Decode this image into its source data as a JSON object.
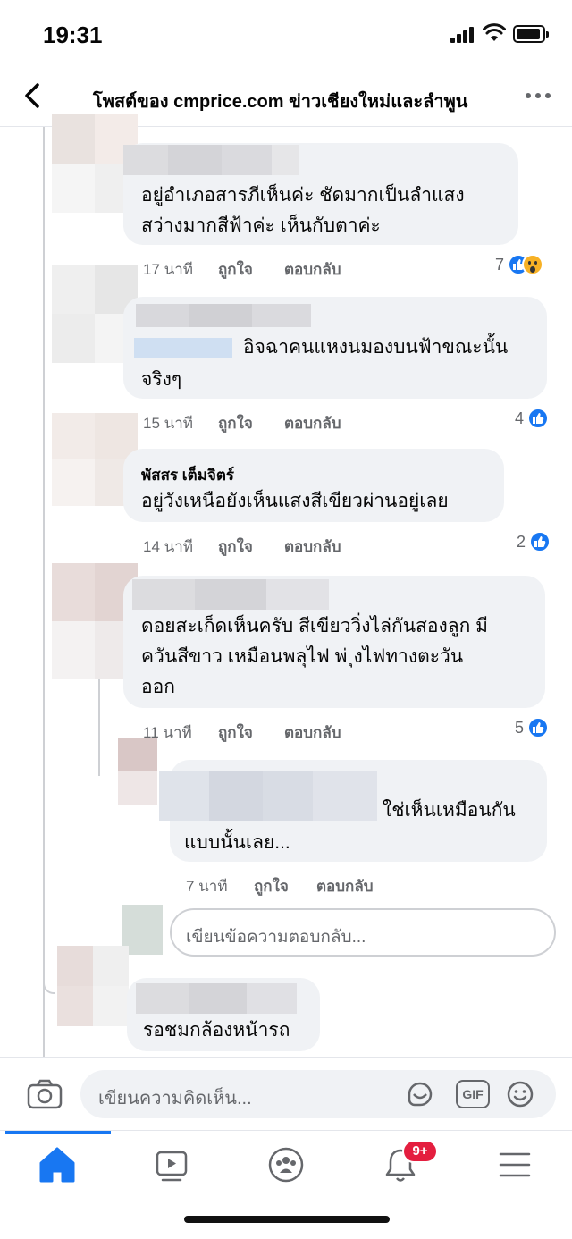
{
  "status_bar": {
    "time": "19:31"
  },
  "header": {
    "title": "โพสต์ของ cmprice.com ข่าวเชียงใหม่และลำพูน"
  },
  "comments": [
    {
      "name": "",
      "text_lines": [
        "อยู่อำเภอสารภีเห็นค่ะ ชัดมากเป็นลำแสง",
        "สว่างมากสีฟ้าค่ะ เห็นกับตาค่ะ"
      ],
      "time": "17 นาที",
      "like": "ถูกใจ",
      "reply": "ตอบกลับ",
      "reactions": "7",
      "reaction_icons": [
        "like-icon",
        "wow-icon"
      ]
    },
    {
      "name": "",
      "text_lines": [
        "อิจฉาคนแหงนมองบนฟ้าขณะนั้น",
        "จริงๆ"
      ],
      "time": "15 นาที",
      "like": "ถูกใจ",
      "reply": "ตอบกลับ",
      "reactions": "4",
      "reaction_icons": [
        "like-icon"
      ]
    },
    {
      "name": "พัสสร เต็มจิตร์",
      "text_lines": [
        "อยู่วังเหนือยังเห็นแสงสีเขียวผ่านอยู่เลย"
      ],
      "time": "14 นาที",
      "like": "ถูกใจ",
      "reply": "ตอบกลับ",
      "reactions": "2",
      "reaction_icons": [
        "like-icon"
      ]
    },
    {
      "name": "",
      "text_lines": [
        "ดอยสะเก็ดเห็นครับ สีเขียววิ่งไล่กันสองลูก มี",
        "ควันสีขาว เหมือนพลุไฟ   พ่ ุงไฟทางตะวัน",
        "ออก"
      ],
      "time": "11 นาที",
      "like": "ถูกใจ",
      "reply": "ตอบกลับ",
      "reactions": "5",
      "reaction_icons": [
        "like-icon"
      ]
    }
  ],
  "reply": {
    "text_lines": [
      "ใช่เห็นเหมือนกัน",
      "แบบนั้นเลย..."
    ],
    "time": "7 นาที",
    "like": "ถูกใจ",
    "reply": "ตอบกลับ"
  },
  "reply_input": {
    "placeholder": "เขียนข้อความตอบกลับ..."
  },
  "last_comment": {
    "text": "รอชมกล้องหน้ารถ"
  },
  "composer": {
    "placeholder": "เขียนความคิดเห็น...",
    "gif_label": "GIF"
  },
  "tabbar": {
    "tabs": [
      "home",
      "watch",
      "groups",
      "notifications",
      "menu"
    ],
    "notification_badge": "9+"
  },
  "colors": {
    "accent": "#1877f2",
    "bubble": "#f0f2f5",
    "meta": "#65676b",
    "badge": "#e41e3f"
  }
}
